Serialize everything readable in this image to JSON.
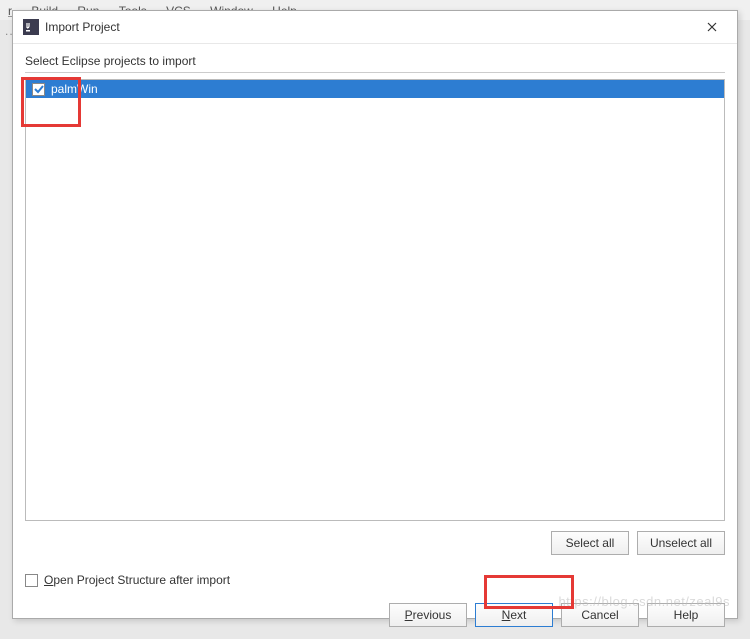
{
  "menubar": {
    "trunc": "r",
    "items": [
      "Build",
      "Run",
      "Tools",
      "VCS",
      "Window",
      "Help"
    ]
  },
  "dotted": "....",
  "dialog": {
    "title": "Import Project",
    "section_label": "Select Eclipse projects to import",
    "projects": [
      {
        "name": "palmWin",
        "checked": true
      }
    ],
    "select_all": "Select all",
    "unselect_all": "Unselect all",
    "open_structure_label": "Open Project Structure after import",
    "open_structure_accel": "O"
  },
  "footer": {
    "previous": "Previous",
    "previous_accel": "P",
    "next": "Next",
    "next_accel": "N",
    "cancel": "Cancel",
    "help": "Help"
  },
  "watermark": "https://blog.csdn.net/zeal9s"
}
